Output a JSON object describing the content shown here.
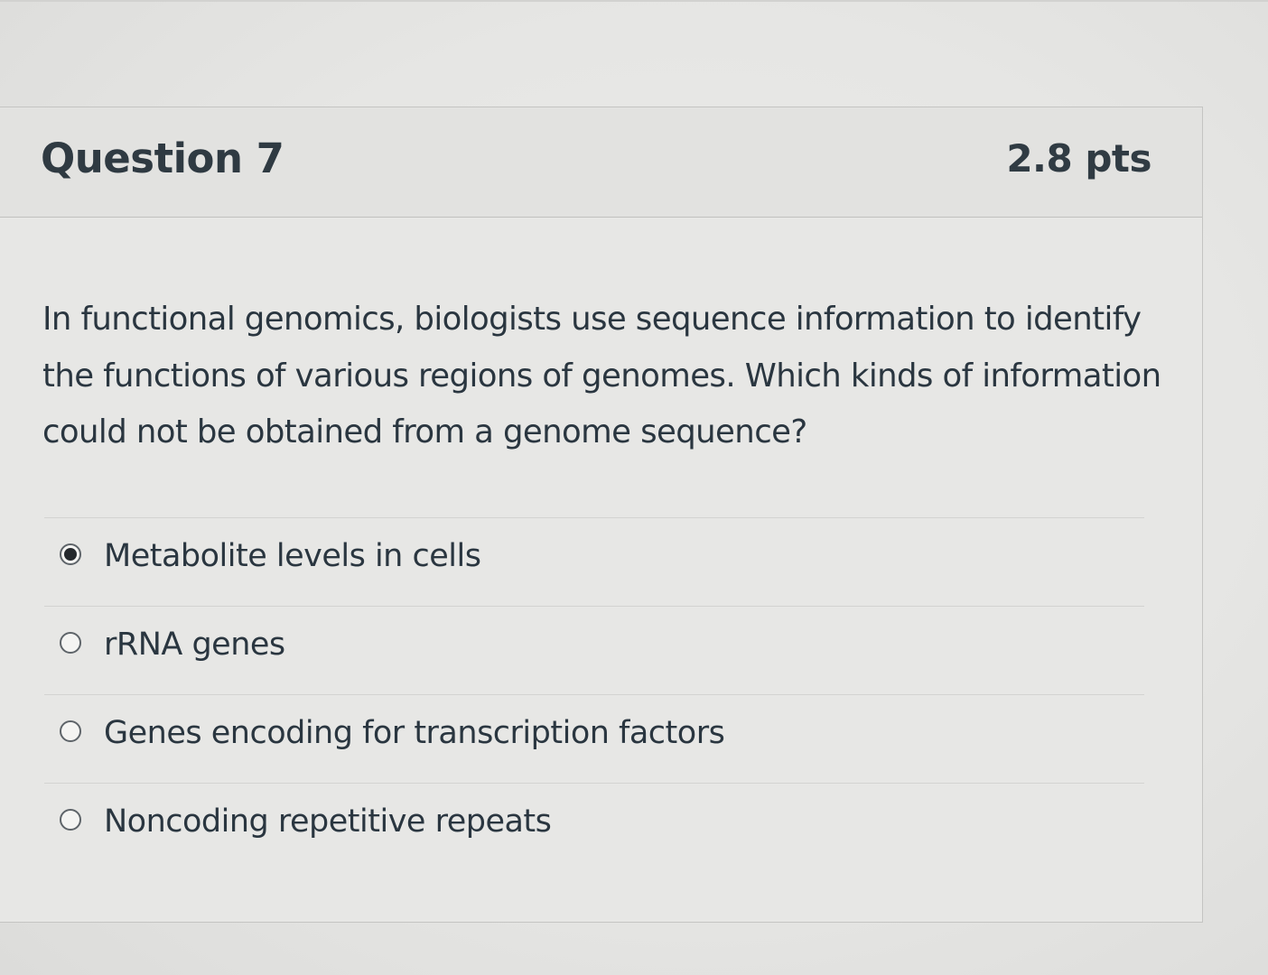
{
  "question": {
    "title": "Question 7",
    "points": "2.8 pts",
    "text": "In functional genomics, biologists use sequence information to identify the functions of various regions of genomes. Which kinds of information could not be obtained from a genome sequence?"
  },
  "answers": [
    {
      "label": "Metabolite levels in cells",
      "selected": true
    },
    {
      "label": "rRNA genes",
      "selected": false
    },
    {
      "label": "Genes encoding for transcription factors",
      "selected": false
    },
    {
      "label": "Noncoding repetitive repeats",
      "selected": false
    }
  ]
}
